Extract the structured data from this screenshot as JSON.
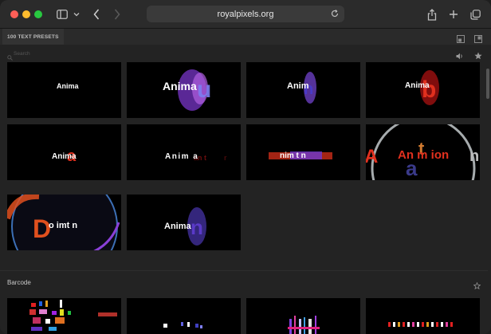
{
  "browser": {
    "url": "royalpixels.org",
    "icons": [
      "sidebar-icon",
      "chevron-down-icon",
      "back-icon",
      "forward-icon",
      "reload-icon",
      "share-icon",
      "new-tab-icon",
      "tabs-overview-icon"
    ]
  },
  "panel": {
    "tab_label": "100 TEXT PRESETS",
    "search_placeholder": "Search",
    "presets": [
      {
        "text": "Anima"
      },
      {
        "text": "Anima"
      },
      {
        "text": "Anim"
      },
      {
        "text": "Anima"
      },
      {
        "text": "Anima"
      },
      {
        "text": "Anim  a"
      },
      {
        "text": "nim  t  n"
      },
      {
        "text": "An  m  ion"
      },
      {
        "text": "o  imt n"
      },
      {
        "text": "Anima"
      }
    ]
  },
  "section": {
    "title": "Barcode"
  },
  "colors": {
    "background": "#232323",
    "tile_background": "#000000",
    "accent_red": "#e0301e",
    "accent_purple": "#8a40d8"
  }
}
